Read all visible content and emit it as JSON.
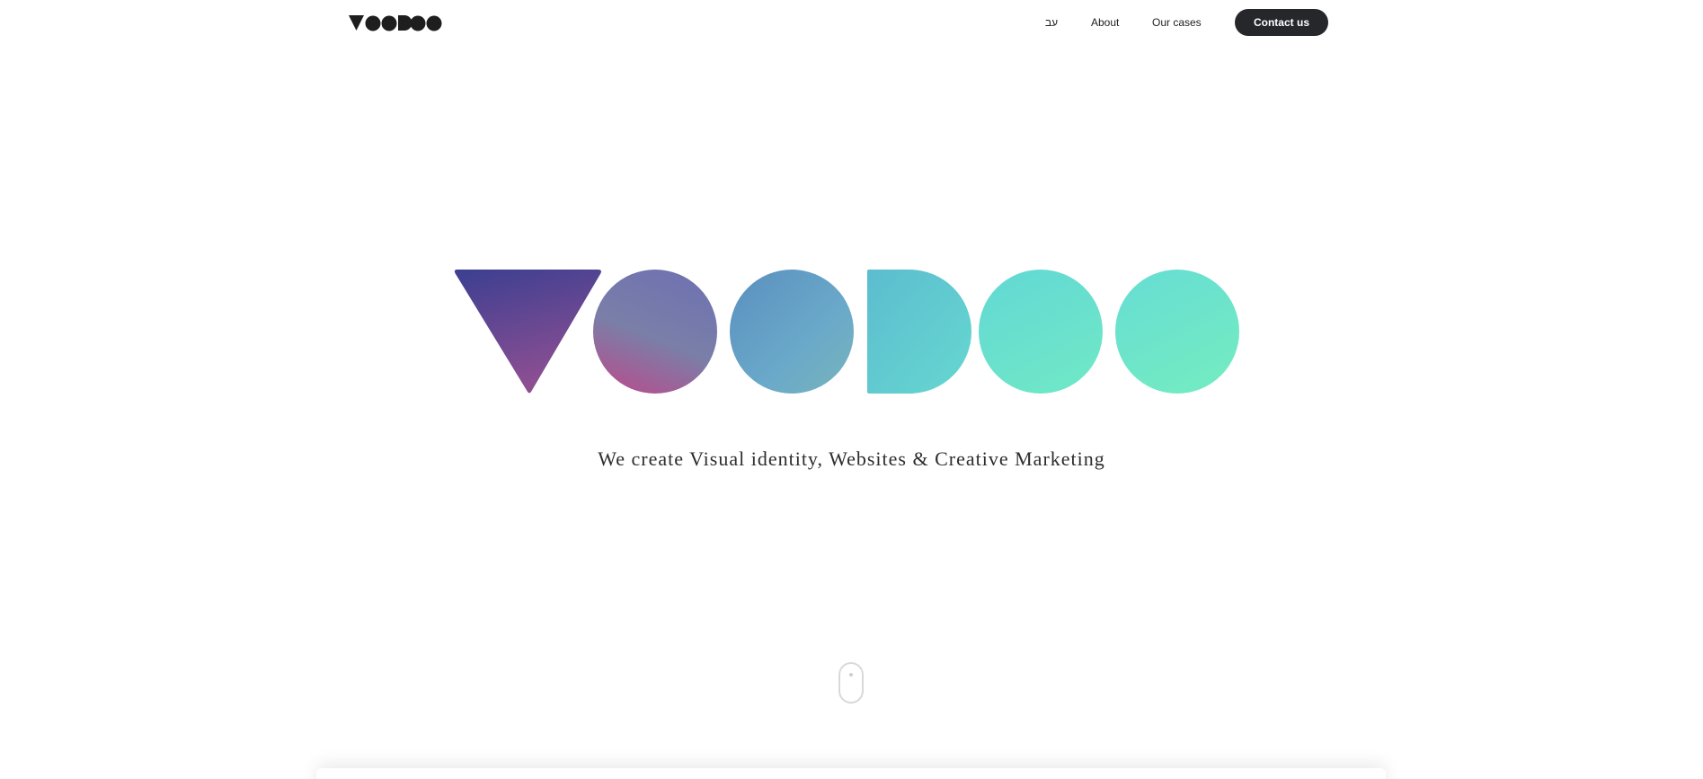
{
  "header": {
    "logo_alt": "VOODOO",
    "nav": {
      "lang_label": "עב",
      "about_label": "About",
      "cases_label": "Our cases"
    },
    "contact_label": "Contact us"
  },
  "hero": {
    "logo_alt": "VOODOO",
    "tagline": "We create Visual identity, Websites & Creative Marketing"
  },
  "scroll": {
    "icon": "mouse-scroll-icon"
  },
  "colors": {
    "button_bg": "#26272a",
    "logo_dark": "#1e1e1e",
    "gradient_start": "#3b3f91",
    "gradient_pink": "#a0588f",
    "gradient_mid": "#5aa6c3",
    "gradient_end": "#6fe8c6"
  }
}
